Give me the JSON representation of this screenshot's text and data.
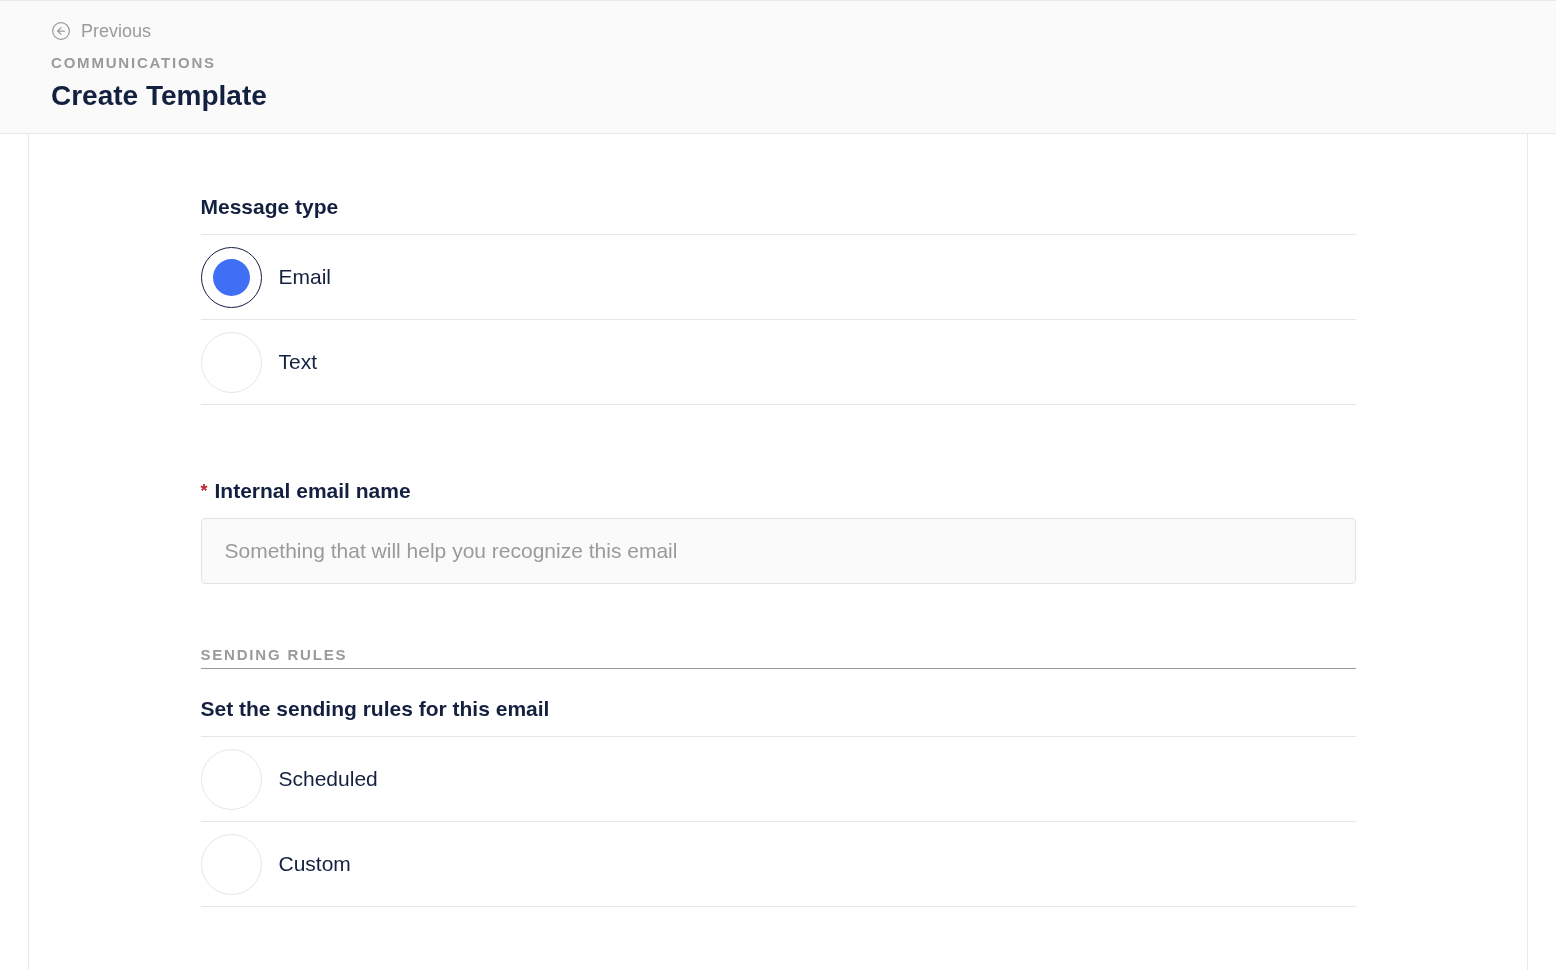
{
  "header": {
    "back_link": "Previous",
    "section": "COMMUNICATIONS",
    "title": "Create Template"
  },
  "message_type": {
    "heading": "Message type",
    "options": [
      {
        "label": "Email",
        "selected": true
      },
      {
        "label": "Text",
        "selected": false
      }
    ]
  },
  "internal_name": {
    "required_mark": "*",
    "label": "Internal email name",
    "placeholder": "Something that will help you recognize this email"
  },
  "sending_rules": {
    "section": "SENDING RULES",
    "heading": "Set the sending rules for this email",
    "options": [
      {
        "label": "Scheduled",
        "selected": false
      },
      {
        "label": "Custom",
        "selected": false
      }
    ]
  }
}
